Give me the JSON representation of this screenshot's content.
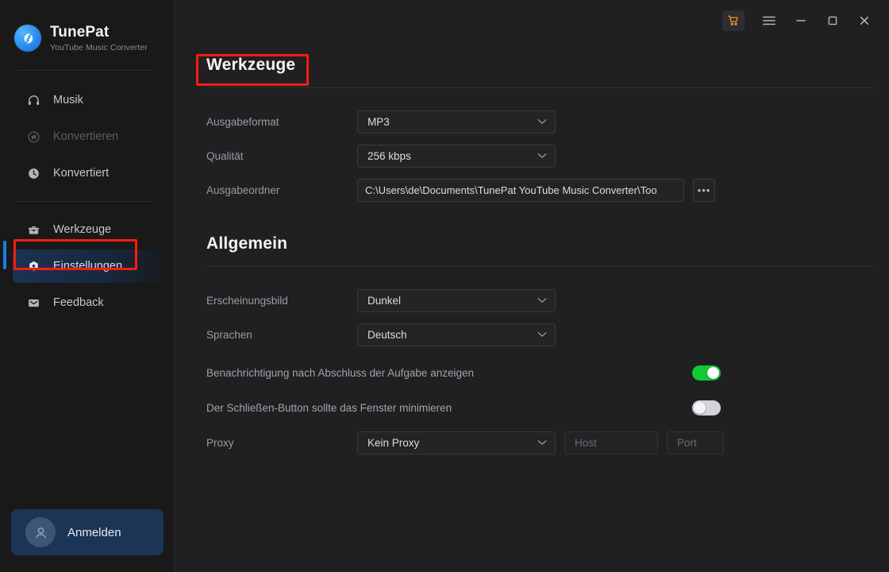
{
  "app": {
    "brand_name": "TunePat",
    "brand_subtitle": "YouTube Music Converter"
  },
  "titlebar": {
    "cart_label": "cart-icon",
    "menu_label": "menu-icon",
    "minimize_label": "minimize-icon",
    "maximize_label": "maximize-icon",
    "close_label": "close-icon"
  },
  "sidebar": {
    "items": [
      {
        "label": "Musik",
        "icon": "headphones-icon",
        "state": "normal"
      },
      {
        "label": "Konvertieren",
        "icon": "convert-icon",
        "state": "disabled"
      },
      {
        "label": "Konvertiert",
        "icon": "history-clock-icon",
        "state": "normal"
      },
      {
        "label": "Werkzeuge",
        "icon": "toolbox-icon",
        "state": "normal"
      },
      {
        "label": "Einstellungen",
        "icon": "gear-icon",
        "state": "active"
      },
      {
        "label": "Feedback",
        "icon": "mail-icon",
        "state": "normal"
      }
    ],
    "signin": {
      "label": "Anmelden",
      "icon": "user-avatar-icon"
    }
  },
  "tools_section": {
    "title": "Werkzeuge",
    "output_format": {
      "label": "Ausgabeformat",
      "value": "MP3"
    },
    "quality": {
      "label": "Qualität",
      "value": "256 kbps"
    },
    "output_folder": {
      "label": "Ausgabeordner",
      "value": "C:\\Users\\de\\Documents\\TunePat YouTube Music Converter\\Too",
      "browse_label": "•••"
    }
  },
  "general_section": {
    "title": "Allgemein",
    "appearance": {
      "label": "Erscheinungsbild",
      "value": "Dunkel"
    },
    "language": {
      "label": "Sprachen",
      "value": "Deutsch"
    },
    "notification": {
      "label": "Benachrichtigung nach Abschluss der Aufgabe anzeigen",
      "state": "on"
    },
    "minimize_on_close": {
      "label": "Der Schließen-Button sollte das Fenster minimieren",
      "state": "off"
    },
    "proxy": {
      "label": "Proxy",
      "value": "Kein Proxy",
      "host_placeholder": "Host",
      "port_placeholder": "Port"
    }
  },
  "annotations": {
    "accent_color": "#f91d0e",
    "highlight_color": "#1a7fe0",
    "toggle_on_color": "#12c938"
  }
}
